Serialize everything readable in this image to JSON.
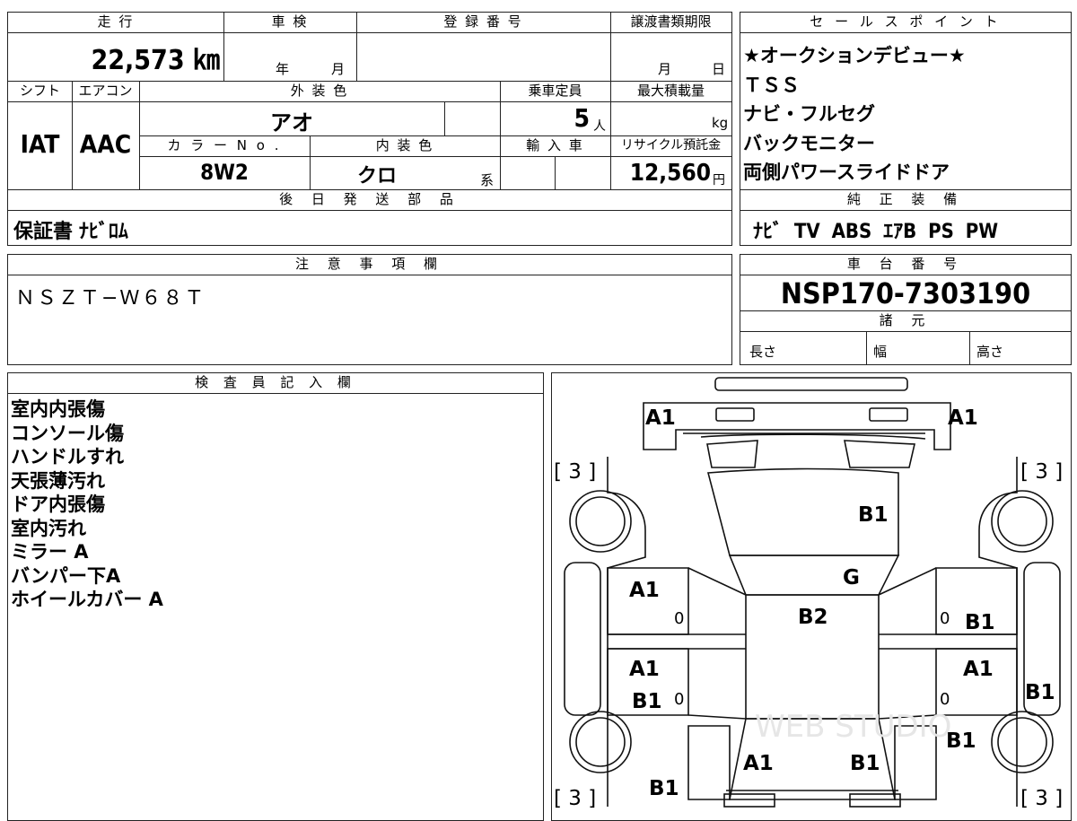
{
  "mileage": {
    "label": "走 行",
    "value": "22,573 ㎞"
  },
  "shaken": {
    "label": "車 検",
    "year": "年",
    "month": "月"
  },
  "registration": {
    "label": "登 録 番 号"
  },
  "transfer": {
    "label": "譲渡書類期限",
    "month": "月",
    "day": "日"
  },
  "shift": {
    "label": "シフト",
    "value": "IAT"
  },
  "aircon": {
    "label": "エアコン",
    "value": "AAC"
  },
  "exterior": {
    "label": "外 装 色",
    "value": "アオ"
  },
  "capacity": {
    "label": "乗車定員",
    "value": "5",
    "unit": "人"
  },
  "maxload": {
    "label": "最大積載量",
    "unit": "kg"
  },
  "color_no": {
    "label": "カ ラ ー N o .",
    "value": "8W2"
  },
  "interior": {
    "label": "内 装 色",
    "value": "クロ",
    "suffix": "系"
  },
  "import": {
    "label": "輸 入 車"
  },
  "recycle": {
    "label": "リサイクル預託金",
    "value": "12,560",
    "unit": "円"
  },
  "later_parts": {
    "label": "後 日 発 送 部 品",
    "value": "保証書 ﾅﾋﾞﾛﾑ"
  },
  "sales": {
    "label": "セ ー ル ス ポ イ ン ト",
    "points": [
      "★オークションデビュー★",
      "ＴＳＳ",
      "ナビ・フルセグ",
      "バックモニター",
      "両側パワースライドドア"
    ]
  },
  "equipment": {
    "label": "純 正 装 備",
    "value": "ﾅﾋﾞ TV ABS ｴｱB PS PW"
  },
  "notes": {
    "label": "注 意 事 項 欄",
    "value": "ＮＳＺＴ−Ｗ６８Ｔ"
  },
  "chassis": {
    "label": "車 台 番 号",
    "value": "NSP170-7303190"
  },
  "specs": {
    "label": "諸 元",
    "length": "長さ",
    "width": "幅",
    "height": "高さ"
  },
  "inspector": {
    "label": "検 査 員 記 入 欄",
    "items": [
      "室内内張傷",
      "コンソール傷",
      "ハンドルすれ",
      "天張薄汚れ",
      "ドア内張傷",
      "室内汚れ",
      "ミラー A",
      "バンパー下A",
      "ホイールカバー A"
    ]
  },
  "damage_codes": {
    "front_left": "A1",
    "front_right": "A1",
    "wheel_fl": "[ 3 ]",
    "wheel_fr": "[ 3 ]",
    "wheel_rl": "[ 3 ]",
    "wheel_rr": "[ 3 ]",
    "hood": "B1",
    "windshield": "G",
    "roof": "B2",
    "left_front_door": "A1",
    "left_rear_door_a": "A1",
    "left_rear_door_b": "B1",
    "right_front_door": "B1",
    "right_rear_door": "A1",
    "right_side_step": "B1",
    "right_rear_quarter": "B1",
    "rear_left": "A1",
    "rear_right": "B1",
    "left_rear_quarter": "B1",
    "zero_1": "0",
    "zero_2": "0",
    "zero_3": "0",
    "zero_4": "0"
  },
  "watermark": "WEB STUDIO"
}
